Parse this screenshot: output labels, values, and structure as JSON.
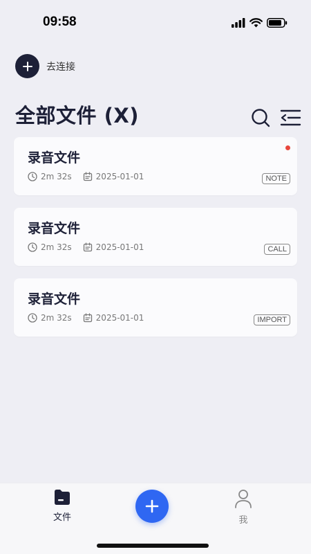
{
  "status_bar": {
    "time": "09:58",
    "icons": [
      "signal-icon",
      "wifi-icon",
      "battery-icon"
    ]
  },
  "connect": {
    "label": "去连接",
    "icon": "plus-icon"
  },
  "page": {
    "title": "全部文件 (X)",
    "actions": [
      "search-icon",
      "menu-collapse-icon"
    ]
  },
  "files": [
    {
      "title": "录音文件",
      "duration": "2m 32s",
      "date": "2025-01-01",
      "tag": "NOTE",
      "unread": true
    },
    {
      "title": "录音文件",
      "duration": "2m 32s",
      "date": "2025-01-01",
      "tag": "CALL",
      "unread": false
    },
    {
      "title": "录音文件",
      "duration": "2m 32s",
      "date": "2025-01-01",
      "tag": "IMPORT",
      "unread": false
    }
  ],
  "tab_bar": {
    "files_label": "文件",
    "me_label": "我",
    "add_icon": "plus-icon"
  },
  "colors": {
    "accent": "#2f67f2",
    "dark": "#1d2037",
    "unread": "#e8473d",
    "background": "#eeeef4"
  }
}
